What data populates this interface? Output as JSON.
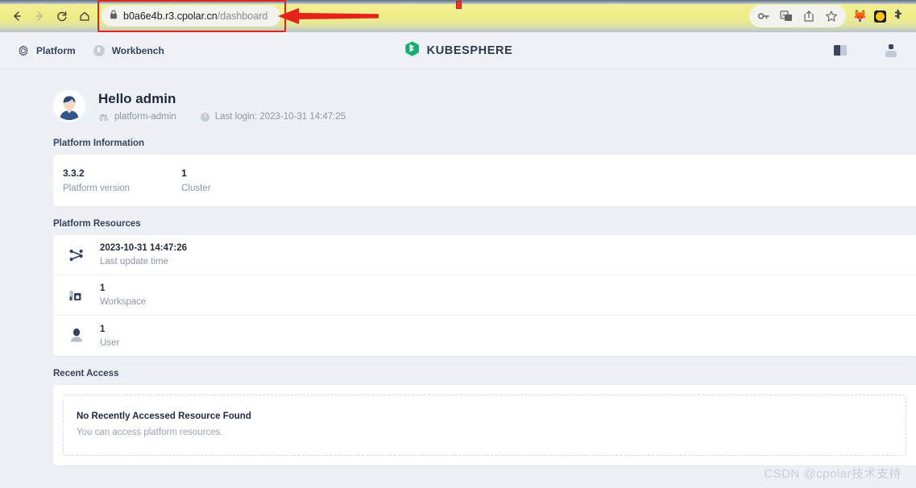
{
  "browser": {
    "back_icon": "back-arrow-icon",
    "forward_icon": "forward-arrow-icon",
    "reload_icon": "reload-icon",
    "home_icon": "home-icon",
    "lock_icon": "lock-icon",
    "url_host": "b0a6e4b.r3.cpolar.cn",
    "url_path": "/dashboard",
    "url_full": "b0a6e4b.r3.cpolar.cn/dashboard",
    "actions": [
      {
        "name": "password-key-icon",
        "glyph": "key"
      },
      {
        "name": "translate-icon",
        "glyph": "translate"
      },
      {
        "name": "share-icon",
        "glyph": "share"
      },
      {
        "name": "bookmark-star-icon",
        "glyph": "star"
      }
    ],
    "extensions": [
      {
        "name": "metamask-fox-icon",
        "glyph": "🦊"
      },
      {
        "name": "wallet-extension-icon",
        "glyph": ""
      },
      {
        "name": "extensions-puzzle-icon",
        "glyph": "✸"
      }
    ],
    "annotation_arrow": "red-arrow-pointing-to-url",
    "highlight_color": "#e5231a"
  },
  "topbar": {
    "nav": [
      {
        "label": "Platform",
        "icon": "gear-icon"
      },
      {
        "label": "Workbench",
        "icon": "workbench-icon"
      }
    ],
    "brand": "KUBESPHERE",
    "brand_color": "#14b071",
    "docs_icon": "docs-book-icon",
    "user_icon": "user-avatar-icon"
  },
  "greeting": {
    "title": "Hello admin",
    "role": "platform-admin",
    "role_icon": "role-icon",
    "last_login": "Last login: 2023-10-31 14:47:25",
    "last_login_icon": "clock-icon",
    "avatar": "user-avatar"
  },
  "platform_information": {
    "title": "Platform Information",
    "items": [
      {
        "value": "3.3.2",
        "label": "Platform version"
      },
      {
        "value": "1",
        "label": "Cluster"
      }
    ]
  },
  "platform_resources": {
    "title": "Platform Resources",
    "items": [
      {
        "value": "2023-10-31 14:47:26",
        "label": "Last update time",
        "icon": "network-share-icon"
      },
      {
        "value": "1",
        "label": "Workspace",
        "icon": "workspace-building-icon"
      },
      {
        "value": "1",
        "label": "User",
        "icon": "user-icon"
      }
    ]
  },
  "recent_access": {
    "title": "Recent Access",
    "empty_title": "No Recently Accessed Resource Found",
    "empty_subtitle": "You can access platform resources."
  },
  "watermark": "CSDN @cpolar技术支持"
}
